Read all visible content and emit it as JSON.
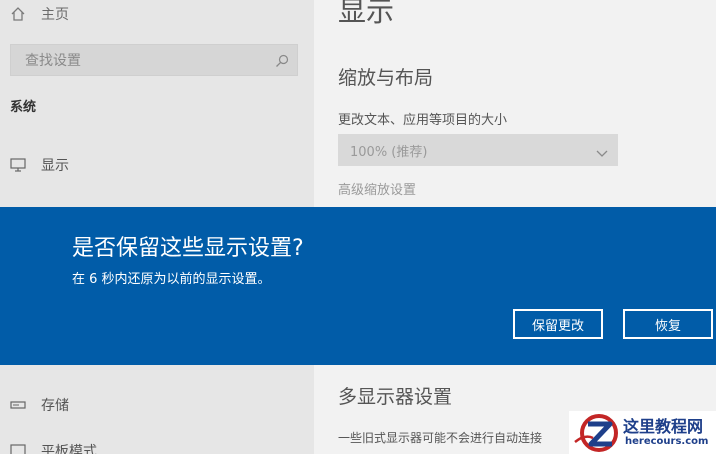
{
  "sidebar": {
    "home_label": "主页",
    "search_placeholder": "查找设置",
    "section_title": "系统",
    "items": [
      {
        "label": "显示",
        "icon": "monitor-icon"
      },
      {
        "label": "存储",
        "icon": "storage-icon"
      },
      {
        "label": "平板模式",
        "icon": "tablet-icon"
      }
    ]
  },
  "main": {
    "page_title": "显示",
    "scale_section_title": "缩放与布局",
    "scale_label": "更改文本、应用等项目的大小",
    "scale_value": "100% (推荐)",
    "advanced_scaling_link": "高级缩放设置",
    "multi_display_title": "多显示器设置",
    "multi_display_text": "一些旧式显示器可能不会进行自动连接"
  },
  "dialog": {
    "title": "是否保留这些显示设置?",
    "message": "在 6 秒内还原为以前的显示设置。",
    "keep_label": "保留更改",
    "revert_label": "恢复",
    "background": "#015ca8"
  },
  "watermark": {
    "name": "这里教程网",
    "url": "herecours.com"
  }
}
